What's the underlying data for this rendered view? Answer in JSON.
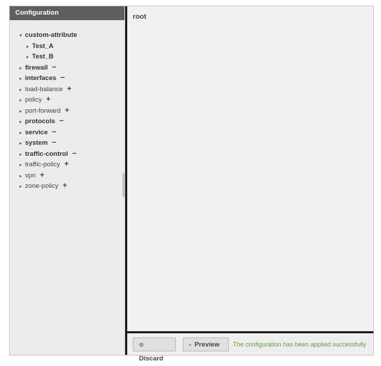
{
  "sidebar": {
    "title": "Configuration",
    "nodes": [
      {
        "label": "custom-attribute",
        "arrow": "▾",
        "level": 0,
        "bold": true,
        "action": ""
      },
      {
        "label": "Test_A",
        "arrow": "▸",
        "level": 1,
        "bold": true,
        "action": ""
      },
      {
        "label": "Test_B",
        "arrow": "▸",
        "level": 1,
        "bold": true,
        "action": ""
      },
      {
        "label": "firewall",
        "arrow": "▸",
        "level": 0,
        "bold": true,
        "action": "−"
      },
      {
        "label": "interfaces",
        "arrow": "▸",
        "level": 0,
        "bold": true,
        "action": "−"
      },
      {
        "label": "load-balance",
        "arrow": "▸",
        "level": 0,
        "bold": false,
        "action": "+"
      },
      {
        "label": "policy",
        "arrow": "▸",
        "level": 0,
        "bold": false,
        "action": "+"
      },
      {
        "label": "port-forward",
        "arrow": "▸",
        "level": 0,
        "bold": false,
        "action": "+"
      },
      {
        "label": "protocols",
        "arrow": "▸",
        "level": 0,
        "bold": true,
        "action": "−"
      },
      {
        "label": "service",
        "arrow": "▸",
        "level": 0,
        "bold": true,
        "action": "−"
      },
      {
        "label": "system",
        "arrow": "▸",
        "level": 0,
        "bold": true,
        "action": "−"
      },
      {
        "label": "traffic-control",
        "arrow": "▸",
        "level": 0,
        "bold": true,
        "action": "−"
      },
      {
        "label": "traffic-policy",
        "arrow": "▸",
        "level": 0,
        "bold": false,
        "action": "+"
      },
      {
        "label": "vpn",
        "arrow": "▸",
        "level": 0,
        "bold": false,
        "action": "+"
      },
      {
        "label": "zone-policy",
        "arrow": "▸",
        "level": 0,
        "bold": false,
        "action": "+"
      }
    ]
  },
  "main": {
    "title": "root"
  },
  "footer": {
    "discard_icon": "⊘",
    "discard_label": "Discard",
    "preview_icon": "▪",
    "preview_label": "Preview",
    "status": "The configuration has been applied successfully"
  },
  "colors": {
    "header_bg": "#5f5f5f",
    "status_text": "#6a9a3a",
    "divider": "#1c1c1c"
  }
}
